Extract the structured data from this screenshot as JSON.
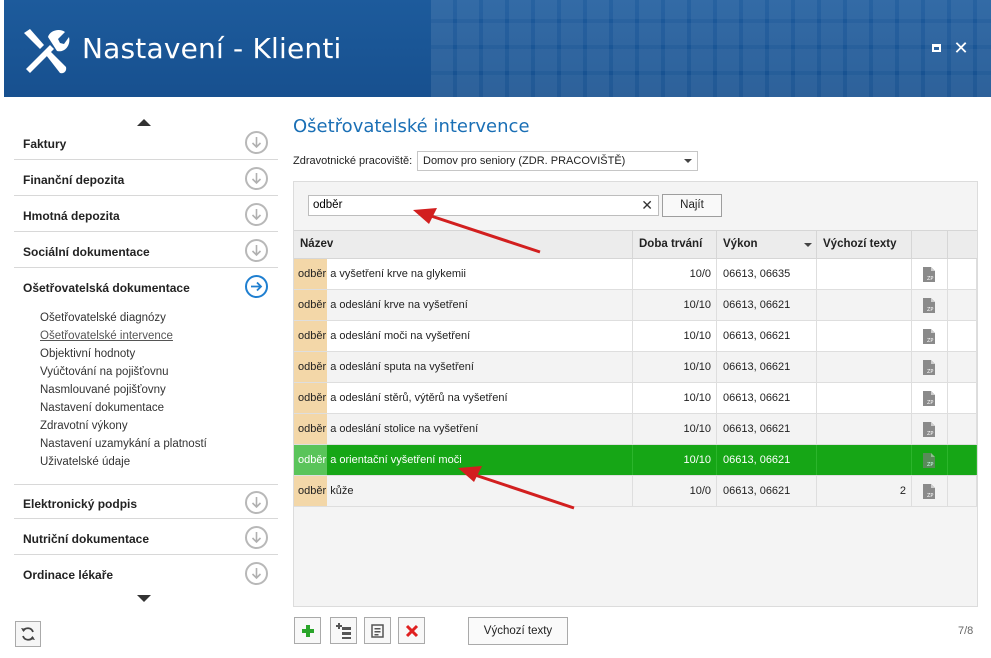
{
  "window": {
    "title": "Nastavení - Klienti"
  },
  "sidebar": {
    "sections": [
      {
        "label": "Faktury"
      },
      {
        "label": "Finanční depozita"
      },
      {
        "label": "Hmotná depozita"
      },
      {
        "label": "Sociální dokumentace"
      },
      {
        "label": "Ošetřovatelská dokumentace"
      },
      {
        "label": "Elektronický podpis"
      },
      {
        "label": "Nutriční dokumentace"
      },
      {
        "label": "Ordinace lékaře"
      }
    ],
    "sub_items": [
      {
        "label": "Ošetřovatelské diagnózy"
      },
      {
        "label": "Ošetřovatelské intervence"
      },
      {
        "label": "Objektivní hodnoty"
      },
      {
        "label": "Vyúčtování na pojišťovnu"
      },
      {
        "label": "Nasmlouvané pojišťovny"
      },
      {
        "label": "Nastavení dokumentace"
      },
      {
        "label": "Zdravotní výkony"
      },
      {
        "label": "Nastavení uzamykání a platností"
      },
      {
        "label": "Uživatelské údaje"
      }
    ]
  },
  "main": {
    "title": "Ošetřovatelské intervence",
    "workplace_label": "Zdravotnické pracoviště:",
    "workplace_value": "Domov pro seniory (ZDR. PRACOVIŠTĚ)",
    "search_value": "odběr",
    "find_label": "Najít",
    "columns": {
      "name": "Název",
      "duration": "Doba trvání",
      "vykon": "Výkon",
      "default_texts": "Výchozí texty"
    },
    "rows": [
      {
        "match": "odběr",
        "rest": " a vyšetření krve na glykemii",
        "duration": "10/0",
        "vykon": "06613, 06635",
        "default_texts": ""
      },
      {
        "match": "odběr",
        "rest": " a odeslání krve na vyšetření",
        "duration": "10/10",
        "vykon": "06613, 06621",
        "default_texts": ""
      },
      {
        "match": "odběr",
        "rest": " a odeslání moči na vyšetření",
        "duration": "10/10",
        "vykon": "06613, 06621",
        "default_texts": ""
      },
      {
        "match": "odběr",
        "rest": " a odeslání sputa na vyšetření",
        "duration": "10/10",
        "vykon": "06613, 06621",
        "default_texts": ""
      },
      {
        "match": "odběr",
        "rest": " a odeslání stěrů, výtěrů na vyšetření",
        "duration": "10/10",
        "vykon": "06613, 06621",
        "default_texts": ""
      },
      {
        "match": "odběr",
        "rest": " a odeslání stolice na vyšetření",
        "duration": "10/10",
        "vykon": "06613, 06621",
        "default_texts": ""
      },
      {
        "match": "odběr",
        "rest": " a orientační vyšetření moči",
        "duration": "10/10",
        "vykon": "06613, 06621",
        "default_texts": ""
      },
      {
        "match": "odběr",
        "rest": " kůže",
        "duration": "10/0",
        "vykon": "06613, 06621",
        "default_texts": "2"
      }
    ],
    "default_texts_button": "Výchozí texty",
    "pager": "7/8"
  },
  "icons": {
    "header": "tools-icon",
    "maximize": "maximize-icon",
    "close": "close-icon",
    "section": "chevron-down-circle-icon",
    "section_active": "arrow-right-circle-icon",
    "refresh": "refresh-icon",
    "add": "plus-icon",
    "add_sub": "add-sub-item-icon",
    "edit": "edit-icon",
    "delete": "delete-icon",
    "doc": "document-zp-icon"
  },
  "colors": {
    "header_bg": "#1d5b9c",
    "accent": "#1a6fb5",
    "selected_row": "#16a616",
    "highlight": "#f3d7a8",
    "delete": "#e02020",
    "add": "#2aa52a",
    "arrow": "#d21f1f"
  }
}
